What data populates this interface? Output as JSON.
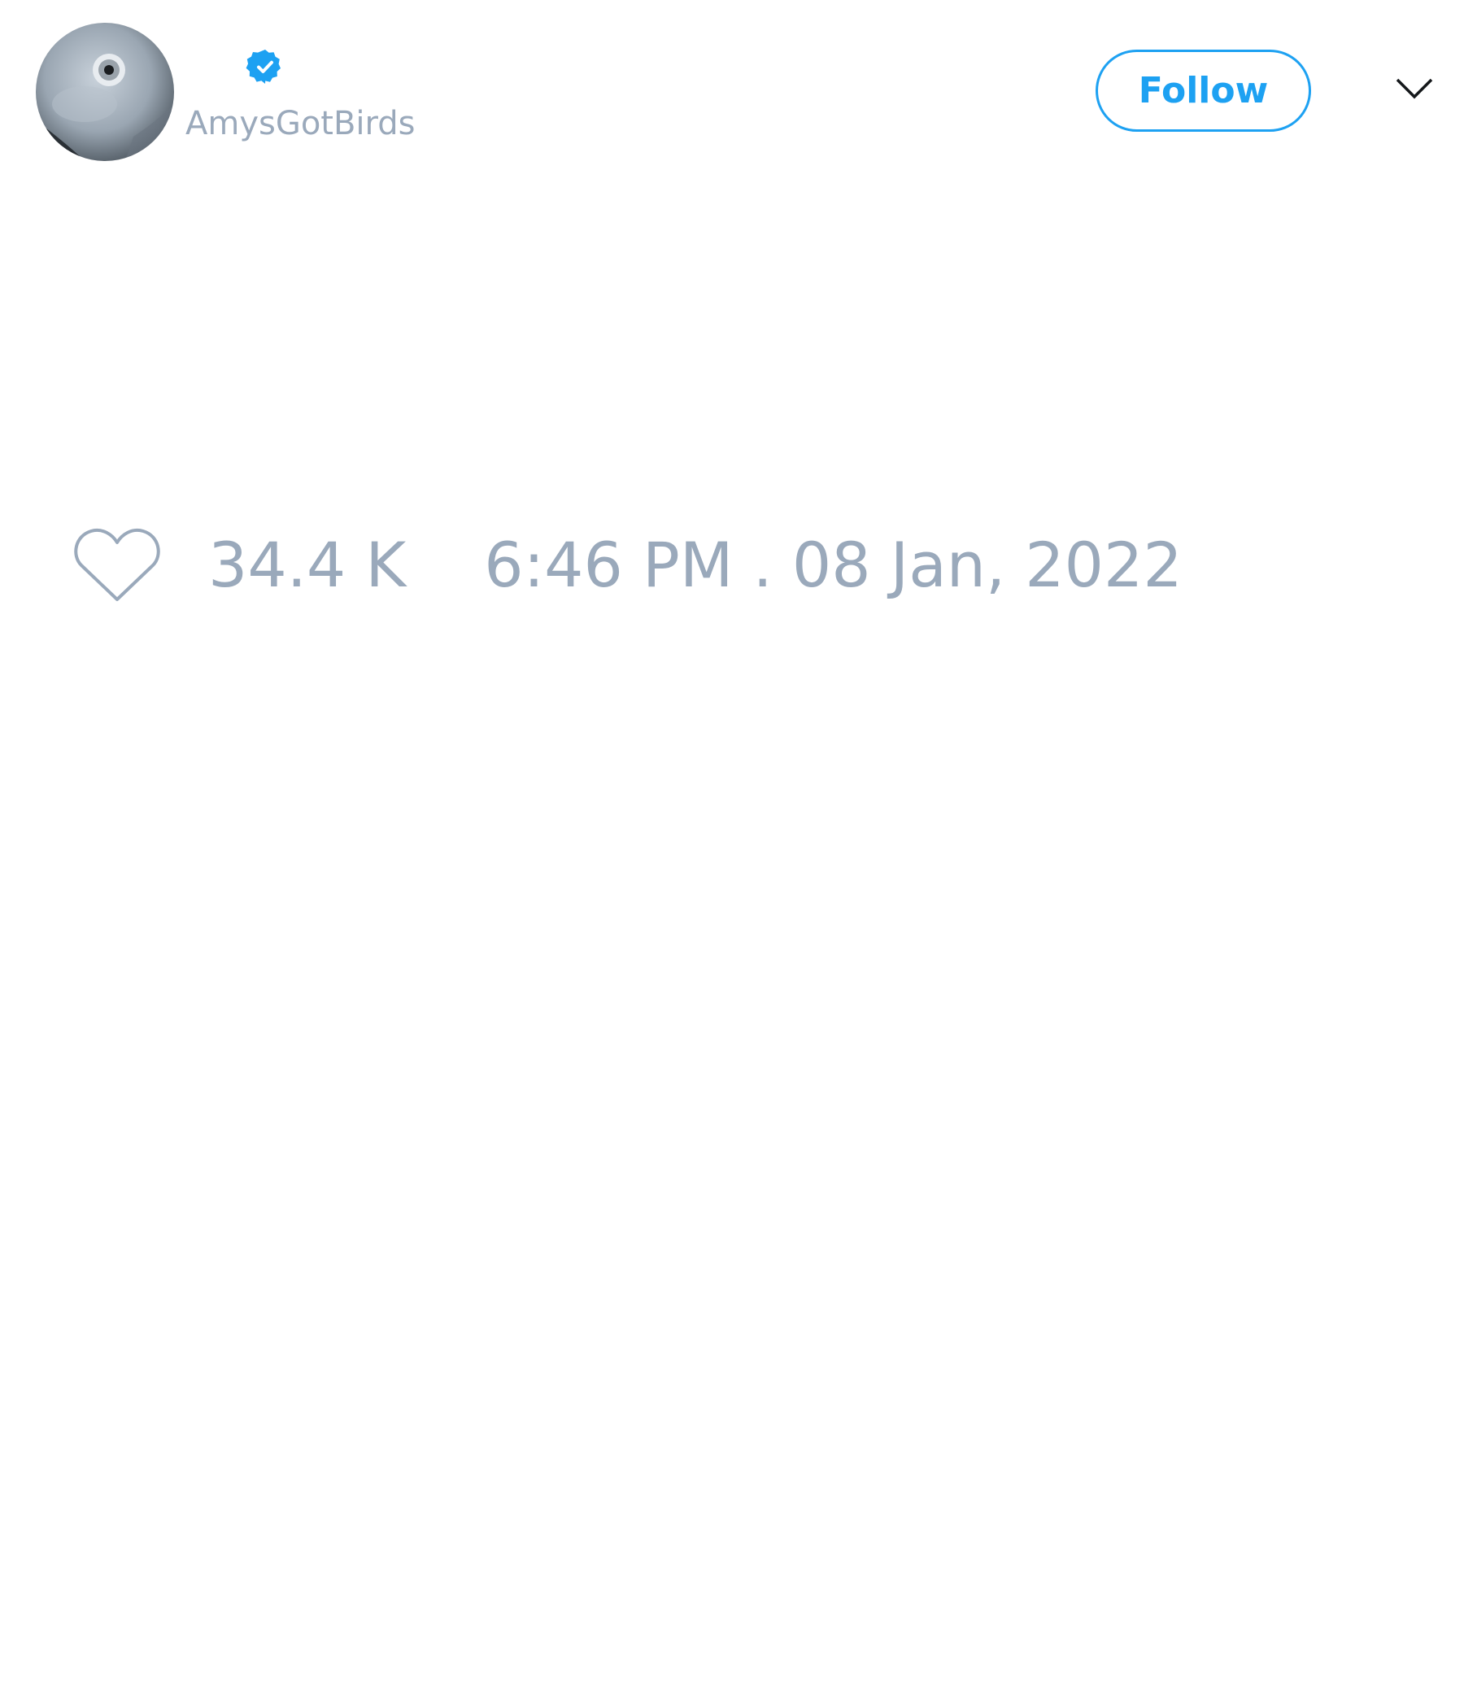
{
  "tweet": {
    "author": {
      "display_name": "",
      "handle": "AmysGotBirds",
      "verified": true,
      "avatar": "parrot-eye-closeup"
    },
    "follow_label": "Follow",
    "likes": "34.4 K",
    "timestamp": "6:46 PM . 08 Jan, 2022"
  },
  "icons": {
    "verified": "verified-badge-icon",
    "menu": "chevron-down-icon",
    "like": "heart-icon"
  },
  "colors": {
    "accent": "#1da1f2",
    "muted_text": "#9aa9bb",
    "background": "#ffffff"
  }
}
